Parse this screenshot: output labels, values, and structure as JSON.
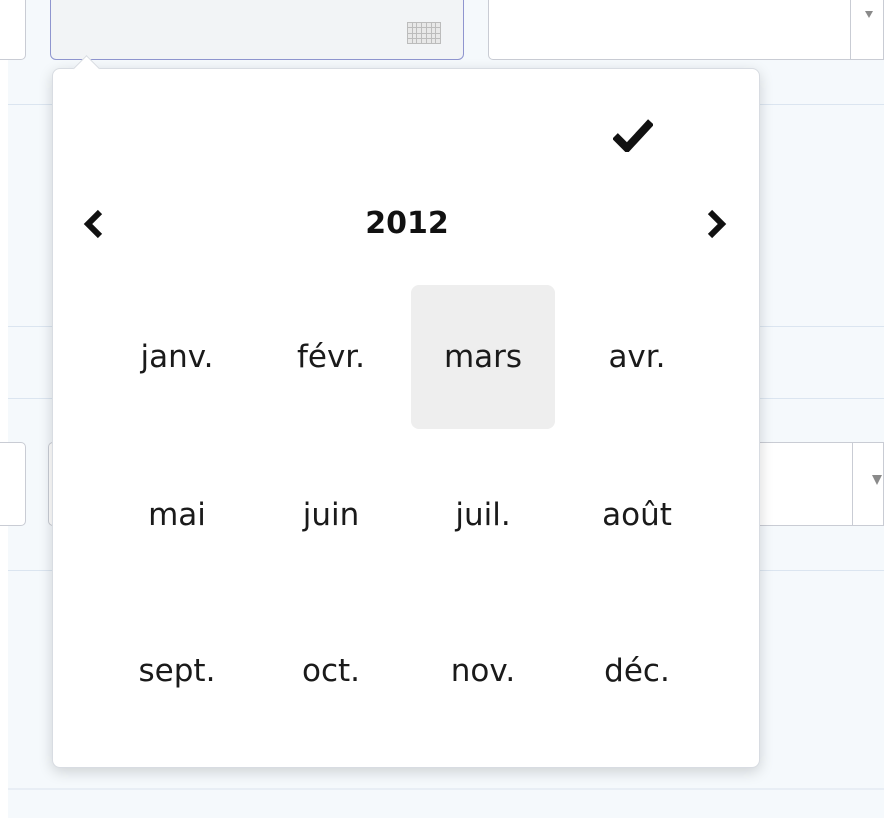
{
  "picker": {
    "year": "2012",
    "selected_month_index": 2,
    "months": [
      "janv.",
      "févr.",
      "mars",
      "avr.",
      "mai",
      "juin",
      "juil.",
      "août",
      "sept.",
      "oct.",
      "nov.",
      "déc."
    ]
  },
  "icons": {
    "confirm": "check-icon",
    "previous": "chevron-left-icon",
    "next": "chevron-right-icon",
    "calendar": "calendar-icon",
    "dropdown": "chevron-down-icon"
  },
  "colors": {
    "selected_month_bg": "#eeeeee",
    "page_bg": "#f5f9fc",
    "focused_field_border": "#8f95cf",
    "text": "#1a1a1a"
  }
}
